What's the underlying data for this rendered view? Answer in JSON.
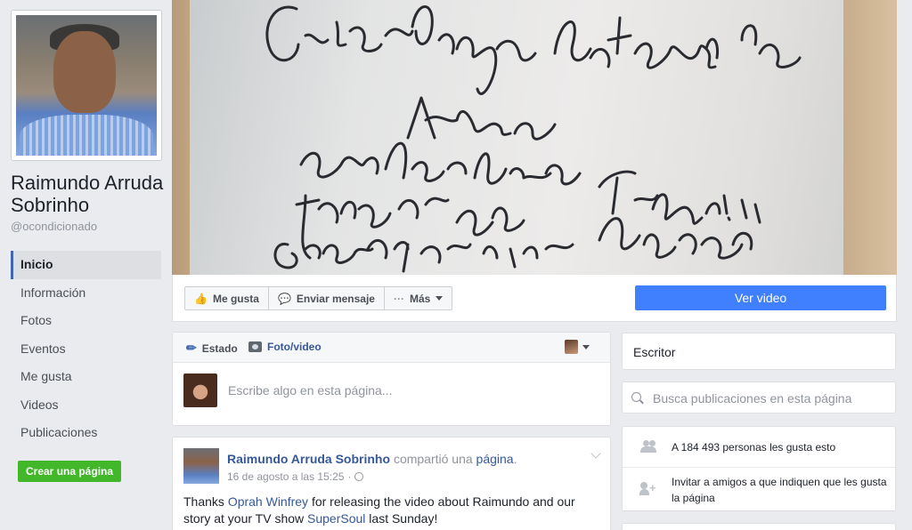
{
  "profile": {
    "name": "Raimundo Arruda Sobrinho",
    "handle": "@ocondicionado"
  },
  "left_nav": {
    "items": [
      {
        "label": "Inicio",
        "active": true
      },
      {
        "label": "Información"
      },
      {
        "label": "Fotos"
      },
      {
        "label": "Eventos"
      },
      {
        "label": "Me gusta"
      },
      {
        "label": "Videos"
      },
      {
        "label": "Publicaciones"
      }
    ],
    "create_page": "Crear una página"
  },
  "actions": {
    "like": "Me gusta",
    "message": "Enviar mensaje",
    "more": "Más",
    "watch_video": "Ver video",
    "accent_color": "#4080ff"
  },
  "composer": {
    "status_tab": "Estado",
    "photo_tab": "Foto/video",
    "placeholder": "Escribe algo en esta página..."
  },
  "post": {
    "author": "Raimundo Arruda Sobrinho",
    "action": "compartió una",
    "object": "página",
    "date": "16 de agosto a las 15:25",
    "text_1": "Thanks ",
    "mention_1": "Oprah Winfrey",
    "text_2": " for releasing the video about Raimundo and our story at your TV show ",
    "mention_2": "SuperSoul",
    "text_3": " last Sunday!"
  },
  "right": {
    "category": "Escritor",
    "search_placeholder": "Busca publicaciones en esta página",
    "likes_text": "A 184 493 personas les gusta esto",
    "invite_text": "Invitar a amigos a que indiquen que les gusta la página"
  },
  "cover": {
    "handwriting_lines": [
      "Gestas Páginas Autógrafas",
      "Missão",
      "andas pelo",
      "inteiro estas",
      "Geometria"
    ]
  }
}
